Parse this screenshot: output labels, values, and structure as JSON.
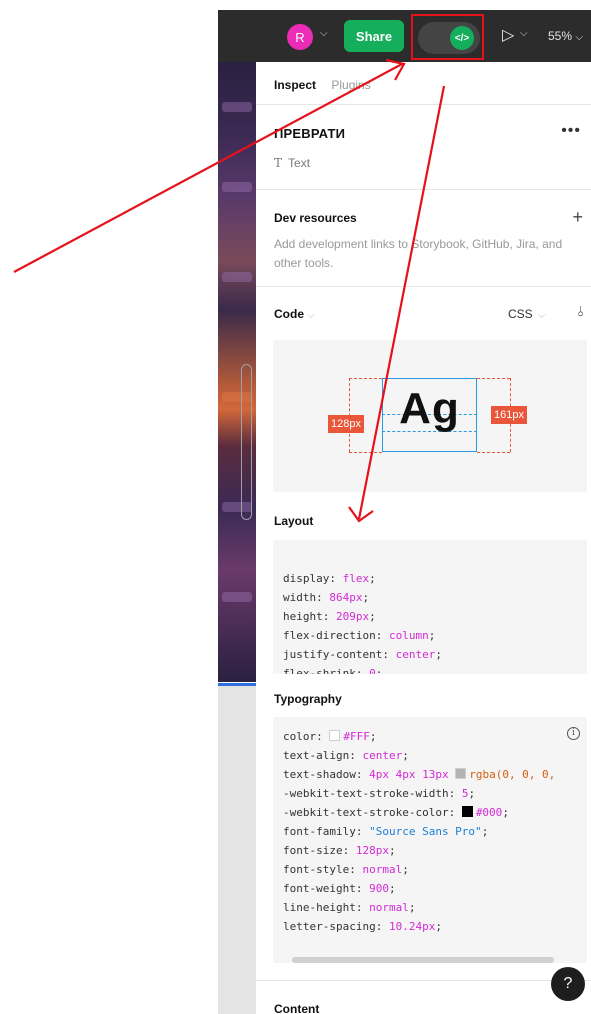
{
  "toolbar": {
    "avatar_initial": "R",
    "share_label": "Share",
    "dev_mode_label": "</>",
    "zoom": "55%"
  },
  "tabs": [
    {
      "label": "Inspect",
      "active": true
    },
    {
      "label": "Plugins",
      "active": false
    }
  ],
  "selection": {
    "title": "ПРЕВРАТИ",
    "type": "Text",
    "more_label": "•••"
  },
  "dev_resources": {
    "title": "Dev resources",
    "description": "Add development links to Storybook, GitHub, Jira, and other tools."
  },
  "code": {
    "label": "Code",
    "language": "CSS"
  },
  "preview": {
    "sample": "Ag",
    "left_measure": "128px",
    "right_measure": "161px"
  },
  "layout": {
    "title": "Layout",
    "lines": [
      {
        "prop": "display",
        "value": "flex"
      },
      {
        "prop": "width",
        "value": "864px"
      },
      {
        "prop": "height",
        "value": "209px"
      },
      {
        "prop": "flex-direction",
        "value": "column"
      },
      {
        "prop": "justify-content",
        "value": "center"
      },
      {
        "prop": "flex-shrink",
        "value": "0"
      }
    ]
  },
  "typography": {
    "title": "Typography",
    "color_value": "#FFF",
    "text_align": "center",
    "text_shadow_offsets": "4px 4px 13px",
    "text_shadow_color": "rgba(0, 0, 0,",
    "stroke_width": "5",
    "stroke_color": "#000",
    "font_family": "\"Source Sans Pro\"",
    "font_size": "128px",
    "font_style": "normal",
    "font_weight": "900",
    "line_height": "normal",
    "letter_spacing": "10.24px"
  },
  "content": {
    "title": "Content"
  },
  "help_label": "?",
  "colors": {
    "annotation_red": "#e5121b",
    "share_green": "#14ae5c",
    "avatar_pink": "#ec2bb7",
    "code_value": "#d32ad6",
    "code_string": "#1c7fd2",
    "measure_orange": "#e9563a",
    "selection_blue": "#2b9ae5"
  }
}
